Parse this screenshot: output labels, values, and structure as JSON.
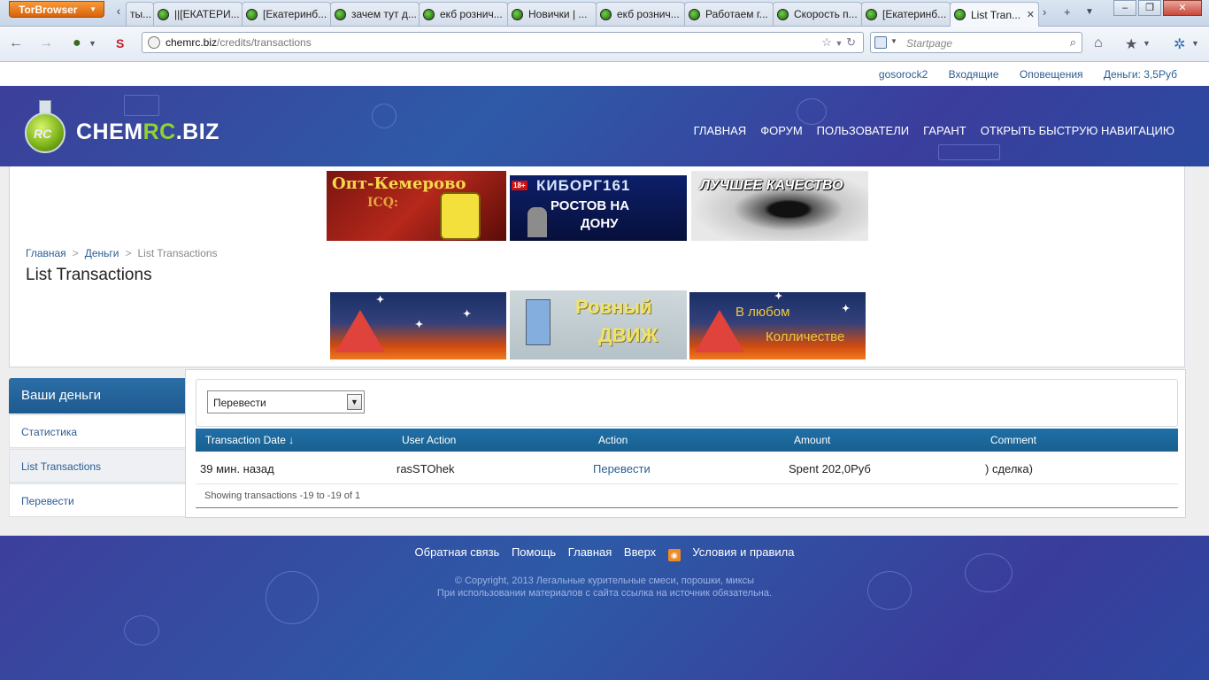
{
  "browser": {
    "menu_label": "TorBrowser",
    "tabs": [
      {
        "title": "ты..."
      },
      {
        "title": "||[ЕКАТЕРИ..."
      },
      {
        "title": "[Екатеринб..."
      },
      {
        "title": "зачем тут д..."
      },
      {
        "title": "екб рознич..."
      },
      {
        "title": "Новички | ..."
      },
      {
        "title": "екб рознич..."
      },
      {
        "title": "Работаем г..."
      },
      {
        "title": "Скорость п..."
      },
      {
        "title": "[Екатеринб..."
      },
      {
        "title": "List Tran...",
        "active": true
      }
    ],
    "url_host": "chemrc.biz",
    "url_path": "/credits/transactions",
    "search_placeholder": "Startpage"
  },
  "userbar": {
    "username": "gosorock2",
    "inbox": "Входящие",
    "alerts": "Оповещения",
    "money": "Деньги: 3,5Руб"
  },
  "header": {
    "logo_prefix": "CHEM",
    "logo_accent": "RC",
    "logo_suffix": ".BIZ",
    "logo_badge": "RC",
    "nav": [
      "ГЛАВНАЯ",
      "ФОРУМ",
      "ПОЛЬЗОВАТЕЛИ",
      "ГАРАНТ",
      "ОТКРЫТЬ БЫСТРУЮ НАВИГАЦИЮ"
    ]
  },
  "banners": {
    "top": [
      {
        "line1": "Опт-Кемерово",
        "line2": "ICQ:"
      },
      {
        "badge": "18+",
        "line1": "КИБОРГ161",
        "line2": "РОСТОВ НА",
        "line3": "ДОНУ"
      },
      {
        "line1": "ЛУЧШЕЕ КАЧЕСТВО"
      }
    ],
    "bottom": [
      {
        "line1": ""
      },
      {
        "line1": "Ровный",
        "line2": "ДВИЖ"
      },
      {
        "line1": "В любом",
        "line2": "Колличестве"
      }
    ]
  },
  "breadcrumb": {
    "home": "Главная",
    "money": "Деньги",
    "current": "List Transactions"
  },
  "page_title": "List Transactions",
  "sidebar": {
    "title": "Ваши деньги",
    "items": [
      "Статистика",
      "List Transactions",
      "Перевести"
    ]
  },
  "filter": {
    "selected": "Перевести"
  },
  "table": {
    "headers": [
      "Transaction Date ↓",
      "User Action",
      "Action",
      "Amount",
      "Comment"
    ],
    "rows": [
      {
        "date": "39 мин. назад",
        "user": "rasSTOhek",
        "action": "Перевести",
        "amount": "Spent 202,0Руб",
        "comment": ") сделка)"
      }
    ],
    "footer": "Showing transactions -19 to -19 of 1"
  },
  "footer": {
    "links": [
      "Обратная связь",
      "Помощь",
      "Главная",
      "Вверх",
      "Условия и правила"
    ],
    "copyright": "© Copyright, 2013 Легальные курительные смеси, порошки, миксы",
    "notice": "При использовании материалов с сайта ссылка на источник обязательна."
  },
  "colors": {
    "header_blue": "#3a4a9e",
    "link": "#2b5e94",
    "table_head": "#1f6fa7",
    "logo_accent": "#8fd42c"
  }
}
